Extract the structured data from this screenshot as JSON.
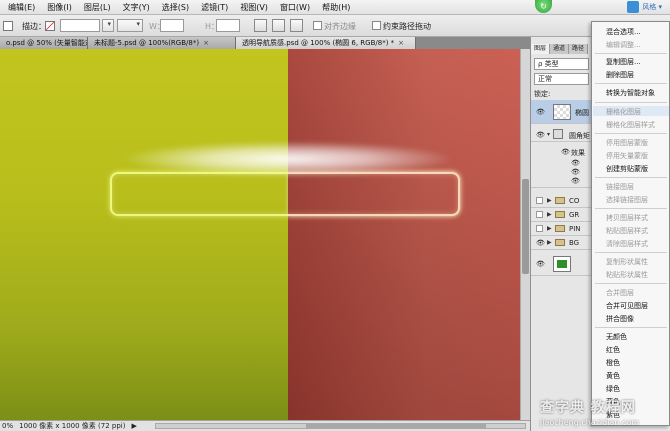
{
  "menubar": {
    "items": [
      "编辑(E)",
      "图像(I)",
      "图层(L)",
      "文字(Y)",
      "选择(S)",
      "滤镜(T)",
      "视图(V)",
      "窗口(W)",
      "帮助(H)"
    ],
    "badge": "↻",
    "brand": "风格 ▾"
  },
  "options": {
    "stroke_label": "描边：",
    "w_label": "W：",
    "h_label": "H：",
    "align_edges": "对齐边缘",
    "constrain_path": "约束路径拖动"
  },
  "tabs": [
    {
      "label": "o.psd @ 50% (矢量智能对象, RGB/8*)",
      "close": "×"
    },
    {
      "label": "未标题-5.psd @ 100%(RGB/8*)",
      "close": "×"
    },
    {
      "label": "透明导航质感.psd @ 100% (椭圆 6, RGB/8*) *",
      "close": "×"
    }
  ],
  "status": {
    "zoom": "0%",
    "doc_info": "1000 像素 x 1000 像素 (72 ppi)",
    "arrow": "▶"
  },
  "panel": {
    "tabs": [
      "图层",
      "通道",
      "路径"
    ],
    "search_placeholder": "ρ 类型",
    "blend_mode": "正常",
    "lock_label": "锁定:",
    "layers": [
      {
        "name": "椭圆",
        "type": "shape",
        "visible": true
      },
      {
        "name": "圆角矩",
        "type": "shape",
        "visible": true
      },
      {
        "name": "效果",
        "type": "effect",
        "visible": true
      },
      {
        "name": "CO",
        "type": "folder",
        "visible": false
      },
      {
        "name": "GR",
        "type": "folder",
        "visible": false
      },
      {
        "name": "PIN",
        "type": "folder",
        "visible": false
      },
      {
        "name": "BG",
        "type": "folder",
        "visible": true
      }
    ]
  },
  "context_menu": {
    "items": [
      {
        "label": "混合选项...",
        "disabled": false
      },
      {
        "label": "编辑调整...",
        "disabled": true
      },
      {
        "label": "复制图层...",
        "disabled": false
      },
      {
        "label": "删除图层",
        "disabled": false
      },
      {
        "label": "转换为智能对象",
        "disabled": false
      },
      {
        "label": "栅格化图层",
        "disabled": true
      },
      {
        "label": "栅格化图层样式",
        "disabled": true
      },
      {
        "label": "停用图层蒙版",
        "disabled": true
      },
      {
        "label": "停用矢量蒙版",
        "disabled": true
      },
      {
        "label": "创建剪贴蒙版",
        "disabled": false
      },
      {
        "label": "链接图层",
        "disabled": true
      },
      {
        "label": "选择链接图层",
        "disabled": true
      },
      {
        "label": "拷贝图层样式",
        "disabled": true
      },
      {
        "label": "粘贴图层样式",
        "disabled": true
      },
      {
        "label": "清除图层样式",
        "disabled": true
      },
      {
        "label": "复制形状属性",
        "disabled": true
      },
      {
        "label": "粘贴形状属性",
        "disabled": true
      },
      {
        "label": "合并图层",
        "disabled": true
      },
      {
        "label": "合并可见图层",
        "disabled": false
      },
      {
        "label": "拼合图像",
        "disabled": false
      },
      {
        "label": "无颜色",
        "disabled": false
      },
      {
        "label": "红色",
        "disabled": false
      },
      {
        "label": "橙色",
        "disabled": false
      },
      {
        "label": "黄色",
        "disabled": false
      },
      {
        "label": "绿色",
        "disabled": false
      },
      {
        "label": "蓝色",
        "disabled": false
      },
      {
        "label": "紫色",
        "disabled": false
      }
    ]
  },
  "watermark": {
    "line1": "查字典 教程网",
    "line2": "jiaocheng.chazidian.com"
  },
  "colors": {
    "canvas_left": "#b8be1b",
    "canvas_right": "#c2574a",
    "layer_thumb_green": "#2f8f2a"
  }
}
